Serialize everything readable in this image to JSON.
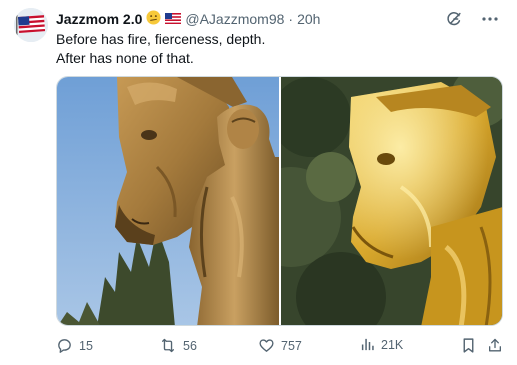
{
  "author": {
    "name": "Jazzmom 2.0",
    "handle": "@AJazzmom98",
    "separator": "·",
    "time": "20h",
    "name_emoji": "😕"
  },
  "tweet": {
    "line1": "Before has fire, fierceness, depth.",
    "line2": "After has none of that."
  },
  "actions": {
    "replies": "15",
    "reposts": "56",
    "likes": "757",
    "views": "21K"
  },
  "colors": {
    "text": "#0f1419",
    "secondary": "#536471",
    "border": "#cfd9de",
    "statue_before": "#b88c4a",
    "statue_after": "#e0b43a",
    "sky": "#7fa9d8",
    "foliage": "#3e4a2e"
  },
  "icons": {
    "grok": "grok-icon",
    "more": "more-dots-icon",
    "reply": "reply-icon",
    "repost": "repost-icon",
    "like": "heart-icon",
    "views": "analytics-icon",
    "bookmark": "bookmark-icon",
    "share": "share-icon",
    "flag": "us-flag-icon"
  }
}
